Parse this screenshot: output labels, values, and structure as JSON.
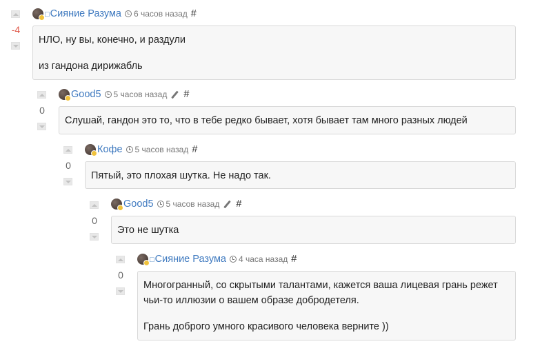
{
  "comments": [
    {
      "author": "Сияние Разума",
      "time": "6 часов назад",
      "score": "-4",
      "hash": "#",
      "paragraphs": [
        "НЛО, ну вы, конечно, и раздули",
        "из гандона дирижабль"
      ]
    },
    {
      "author": "Good5",
      "time": "5 часов назад",
      "score": "0",
      "hash": "#",
      "paragraphs": [
        "Слушай, гандон это то, что в тебе редко бывает, хотя бывает там много разных людей"
      ]
    },
    {
      "author": "Кофе",
      "time": "5 часов назад",
      "score": "0",
      "hash": "#",
      "paragraphs": [
        "Пятый, это плохая шутка. Не надо так."
      ]
    },
    {
      "author": "Good5",
      "time": "5 часов назад",
      "score": "0",
      "hash": "#",
      "paragraphs": [
        "Это не шутка"
      ]
    },
    {
      "author": "Сияние Разума",
      "time": "4 часа назад",
      "score": "0",
      "hash": "#",
      "paragraphs": [
        "Многогранный, со скрытыми талантами, кажется ваша лицевая грань режет чьи-то иллюзии о вашем образе добродетеля.",
        "Грань доброго умного красивого человека верните ))"
      ]
    }
  ],
  "icons": {
    "user_marker": "□",
    "history": "history-icon",
    "edit": "pencil-icon"
  },
  "colors": {
    "author_link": "#3e79bf",
    "negative_score": "#e0594a",
    "comment_bg": "#f7f7f7",
    "avatar_badge": "#f0c23c"
  }
}
